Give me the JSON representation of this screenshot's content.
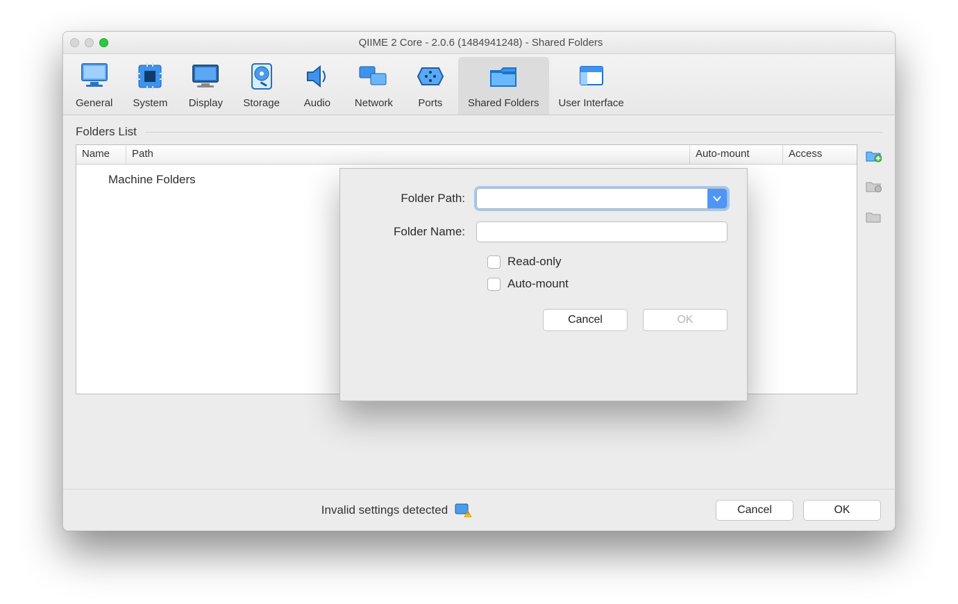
{
  "window": {
    "title": "QIIME 2 Core - 2.0.6 (1484941248) - Shared Folders"
  },
  "toolbar": {
    "items": [
      {
        "label": "General"
      },
      {
        "label": "System"
      },
      {
        "label": "Display"
      },
      {
        "label": "Storage"
      },
      {
        "label": "Audio"
      },
      {
        "label": "Network"
      },
      {
        "label": "Ports"
      },
      {
        "label": "Shared Folders"
      },
      {
        "label": "User Interface"
      }
    ],
    "active_index": 7
  },
  "folders_list": {
    "heading": "Folders List",
    "columns": {
      "name": "Name",
      "path": "Path",
      "automount": "Auto-mount",
      "access": "Access"
    },
    "group_rows": [
      "Machine Folders"
    ]
  },
  "sheet": {
    "folder_path_label": "Folder Path:",
    "folder_path_value": "",
    "folder_name_label": "Folder Name:",
    "folder_name_value": "",
    "readonly_label": "Read-only",
    "readonly_checked": false,
    "automount_label": "Auto-mount",
    "automount_checked": false,
    "cancel": "Cancel",
    "ok": "OK"
  },
  "footer": {
    "invalid_text": "Invalid settings detected",
    "cancel": "Cancel",
    "ok": "OK"
  }
}
